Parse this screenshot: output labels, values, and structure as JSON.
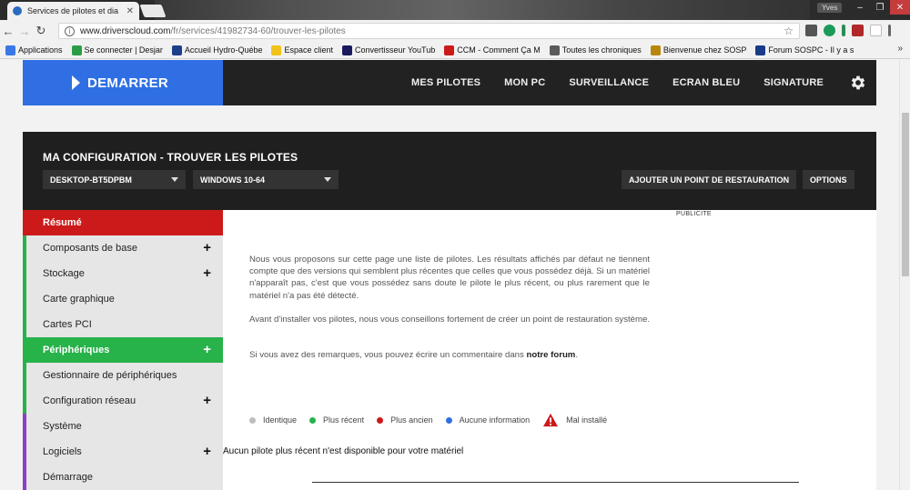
{
  "browser": {
    "tab_title": "Services de pilotes et dia",
    "user_badge": "Yves",
    "address": {
      "domain": "www.driverscloud.com",
      "path": "/fr/services/41982734-60/trouver-les-pilotes"
    },
    "bookmarks": [
      {
        "label": "Applications",
        "icon_color": "#3b78e7"
      },
      {
        "label": "Se connecter | Desjar",
        "icon_color": "#2a9d44"
      },
      {
        "label": "Accueil Hydro-Québe",
        "icon_color": "#1d3f8a"
      },
      {
        "label": "Espace client",
        "icon_color": "#f2c21b"
      },
      {
        "label": "Convertisseur YouTub",
        "icon_color": "#1a1a5e"
      },
      {
        "label": "CCM - Comment Ça M",
        "icon_color": "#cc1a1a"
      },
      {
        "label": "Toutes les chroniques",
        "icon_color": "#5a5a5a"
      },
      {
        "label": "Bienvenue chez SOSP",
        "icon_color": "#b8860b"
      },
      {
        "label": "Forum SOSPC - Il y a s",
        "icon_color": "#1a3a8a"
      }
    ],
    "more_bookmarks": "»"
  },
  "header": {
    "start_label": "DEMARRER",
    "nav": [
      "MES PILOTES",
      "MON PC",
      "SURVEILLANCE",
      "ECRAN BLEU",
      "SIGNATURE"
    ]
  },
  "config": {
    "title": "MA CONFIGURATION - TROUVER LES PILOTES",
    "pc_name": "DESKTOP-BT5DPBM",
    "os": "WINDOWS 10-64",
    "restore_button": "AJOUTER UN POINT DE RESTAURATION",
    "options_button": "OPTIONS"
  },
  "sidebar": {
    "items": [
      {
        "label": "Résumé",
        "style": "red",
        "expandable": false,
        "stripe": ""
      },
      {
        "label": "Composants de base",
        "style": "",
        "expandable": true,
        "stripe": "#27b24a"
      },
      {
        "label": "Stockage",
        "style": "",
        "expandable": true,
        "stripe": "#27b24a"
      },
      {
        "label": "Carte graphique",
        "style": "",
        "expandable": false,
        "stripe": "#27b24a"
      },
      {
        "label": "Cartes PCI",
        "style": "",
        "expandable": false,
        "stripe": "#27b24a"
      },
      {
        "label": "Périphériques",
        "style": "green",
        "expandable": true,
        "stripe": ""
      },
      {
        "label": "Gestionnaire de périphériques",
        "style": "",
        "expandable": false,
        "stripe": "#27b24a"
      },
      {
        "label": "Configuration réseau",
        "style": "",
        "expandable": true,
        "stripe": "#27b24a"
      },
      {
        "label": "Système",
        "style": "",
        "expandable": false,
        "stripe": "#8a3ec9"
      },
      {
        "label": "Logiciels",
        "style": "",
        "expandable": true,
        "stripe": "#8a3ec9"
      },
      {
        "label": "Démarrage",
        "style": "",
        "expandable": false,
        "stripe": "#8a3ec9"
      }
    ]
  },
  "content": {
    "pub": "PUBLICITE",
    "para1": "Nous vous proposons sur cette page une liste de pilotes. Les résultats affichés par défaut ne tiennent compte que des versions qui semblent plus récentes que celles que vous possédez déjà. Si un matériel n'apparaît pas, c'est que vous possédez sans doute le pilote le plus récent, ou plus rarement que le matériel n'a pas été détecté.",
    "para2": "Avant d'installer vos pilotes, nous vous conseillons fortement de créer un point de restauration système.",
    "para3_prefix": "Si vous avez des remarques, vous pouvez écrire un commentaire dans ",
    "para3_link": "notre forum",
    "para3_suffix": ".",
    "legend": [
      {
        "label": "Identique",
        "color": "#bdbdbd"
      },
      {
        "label": "Plus récent",
        "color": "#27b24a"
      },
      {
        "label": "Plus ancien",
        "color": "#cc1a1a"
      },
      {
        "label": "Aucune information",
        "color": "#2f6fe3"
      }
    ],
    "legend_warning": "Mal installé",
    "no_driver": "Aucun pilote plus récent n'est disponible pour votre matériel"
  }
}
